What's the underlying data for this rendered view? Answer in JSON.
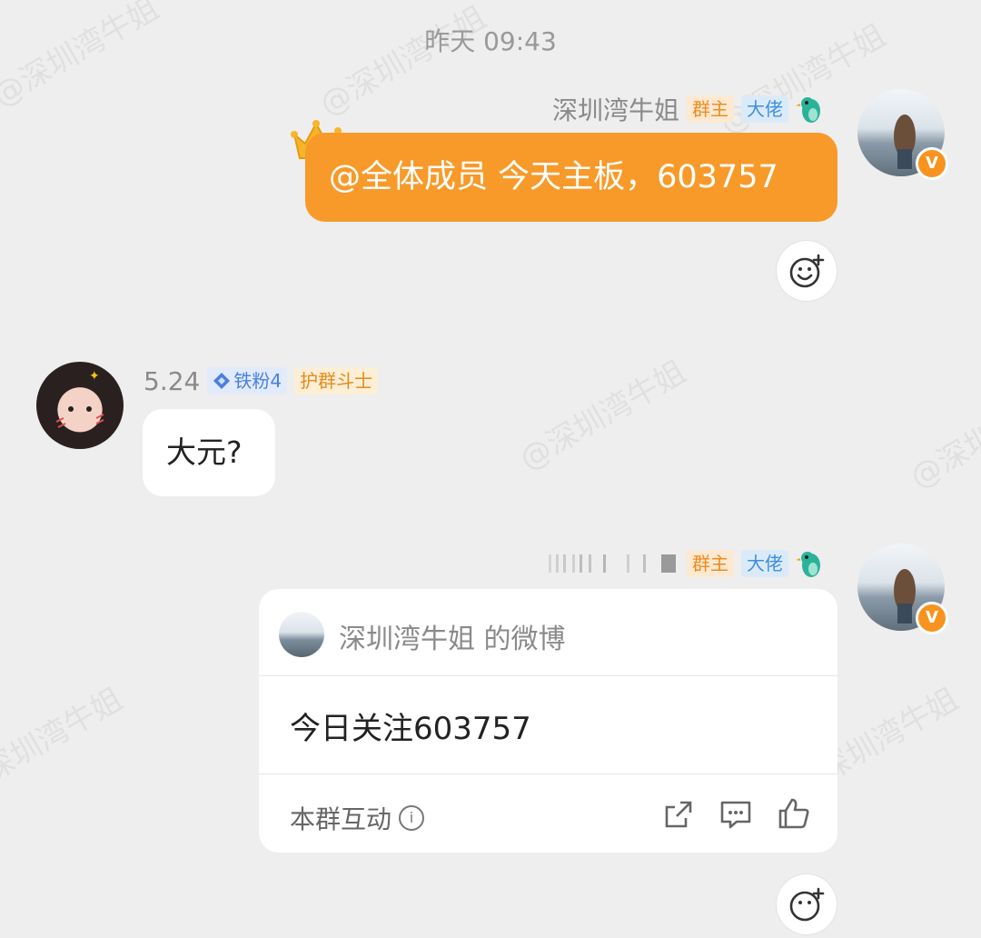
{
  "timestamp": "昨天 09:43",
  "watermark_text": "@深圳湾牛姐",
  "message1": {
    "sender_name": "深圳湾牛姐",
    "badges": [
      "群主",
      "大佬"
    ],
    "text": "@全体成员 今天主板，603757",
    "verified_badge": "V"
  },
  "message2": {
    "sender_name": "5.24",
    "badges": [
      "铁粉4",
      "护群斗士"
    ],
    "text": "大元?"
  },
  "message3": {
    "badges": [
      "群主",
      "大佬"
    ],
    "verified_badge": "V",
    "card": {
      "source": "深圳湾牛姐 的微博",
      "content": "今日关注603757",
      "footer_label": "本群互动",
      "info_icon": "i"
    }
  },
  "colors": {
    "background": "#eeeeee",
    "orange_bubble": "#f79a2a",
    "white_bubble": "#ffffff",
    "owner_badge": "#f08a1c",
    "boss_badge": "#3d8fe0"
  },
  "icons": [
    "crown-icon",
    "bird-icon",
    "emoji-react-icon",
    "share-icon",
    "comment-icon",
    "like-icon",
    "info-icon",
    "fan-diamond-icon"
  ]
}
